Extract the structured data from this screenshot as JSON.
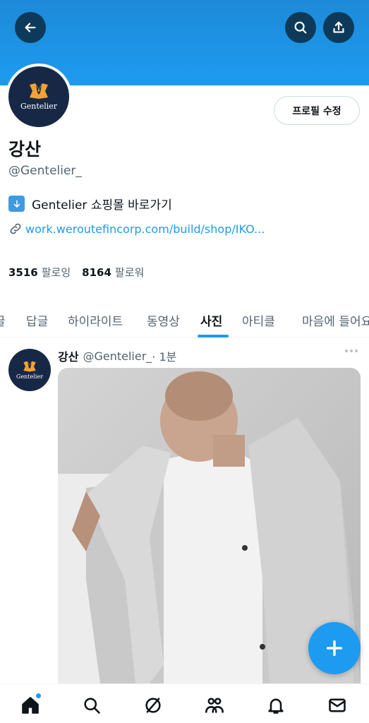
{
  "header": {
    "back_icon": "arrow-left-icon",
    "search_icon": "search-icon",
    "share_icon": "share-icon"
  },
  "profile": {
    "avatar_logo_text": "Gentelier",
    "edit_button_label": "프로필 수정",
    "display_name": "강산",
    "handle": "@Gentelier_",
    "bio_emoji": "arrow-down-emoji",
    "bio_text": "Gentelier 쇼핑몰 바로가기",
    "link_icon": "link-icon",
    "link_text": "work.weroutefincorp.com/build/shop/IKO...",
    "following_count": "3516",
    "following_label": "팔로잉",
    "followers_count": "8164",
    "followers_label": "팔로워"
  },
  "tabs": [
    {
      "label": "글"
    },
    {
      "label": "답글"
    },
    {
      "label": "하이라이트"
    },
    {
      "label": "동영상"
    },
    {
      "label": "사진"
    },
    {
      "label": "아티클"
    },
    {
      "label": "마음에 들어요"
    }
  ],
  "active_tab": "사진",
  "post": {
    "name": "강산",
    "handle": "@Gentelier_",
    "time": " · 1분",
    "avatar_logo_text": "Gentelier",
    "more_icon": "more-dots-icon",
    "media_description": "photo"
  },
  "fab": {
    "icon": "plus-icon"
  },
  "bottom_nav": [
    {
      "icon": "home-icon"
    },
    {
      "icon": "search-icon"
    },
    {
      "icon": "grok-icon"
    },
    {
      "icon": "communities-icon"
    },
    {
      "icon": "bell-icon"
    },
    {
      "icon": "mail-icon"
    }
  ],
  "colors": {
    "accent": "#1d9bf0",
    "banner": "#1d9bf0",
    "avatar_bg": "#172847",
    "text_primary": "#0f1419",
    "text_secondary": "#536471"
  }
}
